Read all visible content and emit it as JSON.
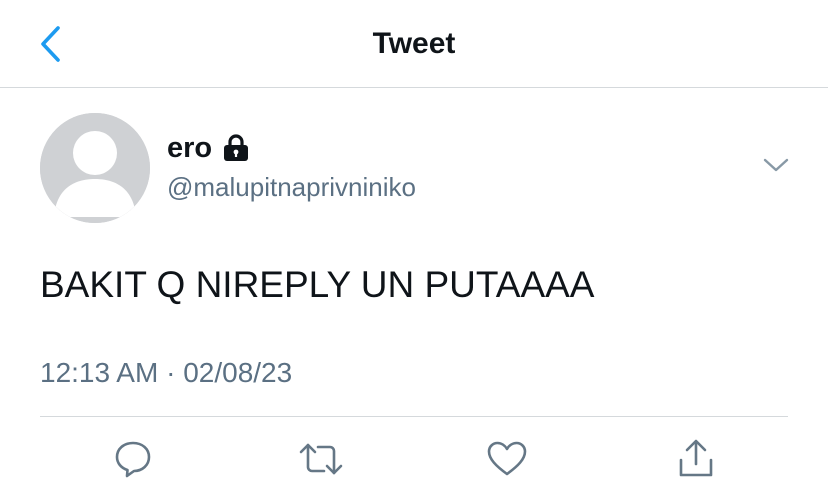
{
  "header": {
    "title": "Tweet",
    "back_icon": "chevron-left-icon"
  },
  "tweet": {
    "author": {
      "display_name": "ero",
      "handle": "@malupitnaprivniniko",
      "protected_icon": "lock-icon",
      "avatar": "default-avatar"
    },
    "text": "BAKIT Q NIREPLY UN PUTAAAA",
    "time": "12:13 AM",
    "separator": "·",
    "date": "02/08/23"
  },
  "actions": [
    {
      "name": "reply",
      "icon": "reply-icon"
    },
    {
      "name": "retweet",
      "icon": "retweet-icon"
    },
    {
      "name": "like",
      "icon": "heart-icon"
    },
    {
      "name": "share",
      "icon": "share-icon"
    }
  ],
  "colors": {
    "accent": "#1d9bf0",
    "text_primary": "#0f1419",
    "text_secondary": "#5b7083",
    "divider": "#d5d9dc",
    "icon_gray": "#657786",
    "avatar_bg": "#cfd1d4"
  }
}
